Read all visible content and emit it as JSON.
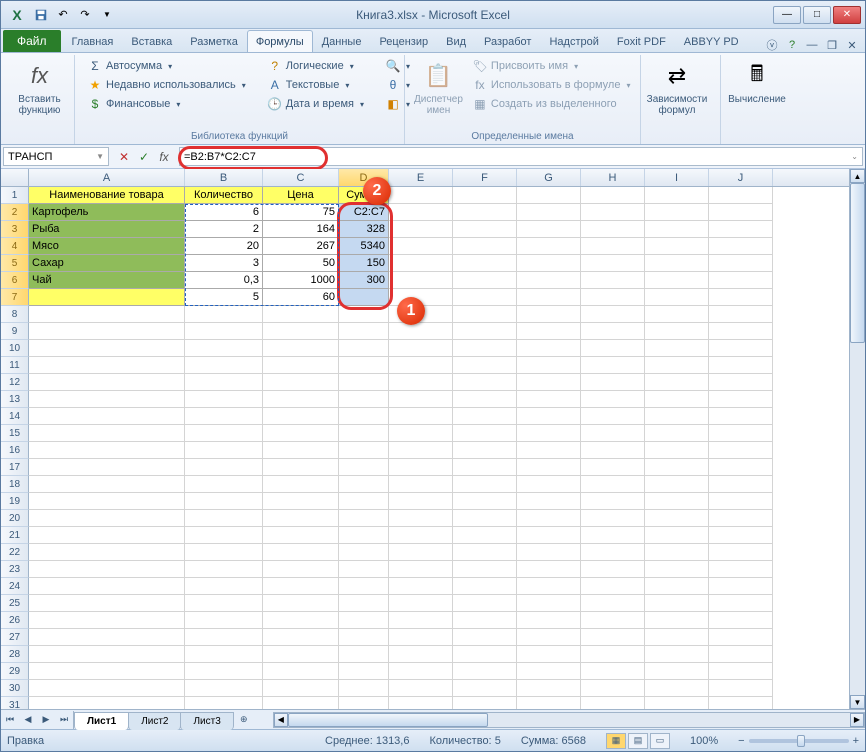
{
  "title": "Книга3.xlsx - Microsoft Excel",
  "ribbon": {
    "file": "Файл",
    "tabs": [
      "Главная",
      "Вставка",
      "Разметка",
      "Формулы",
      "Данные",
      "Рецензир",
      "Вид",
      "Разработ",
      "Надстрой",
      "Foxit PDF",
      "ABBYY PD"
    ],
    "activeTab": "Формулы",
    "groups": {
      "insertFn": {
        "label": "Вставить функцию"
      },
      "lib": {
        "label": "Библиотека функций",
        "autosum": "Автосумма",
        "recent": "Недавно использовались",
        "financial": "Финансовые",
        "logical": "Логические",
        "text": "Текстовые",
        "datetime": "Дата и время"
      },
      "names": {
        "label": "Определенные имена",
        "manager": "Диспетчер имен",
        "assign": "Присвоить имя",
        "useInFormula": "Использовать в формуле",
        "fromSelection": "Создать из выделенного"
      },
      "deps": "Зависимости формул",
      "calc": "Вычисление"
    }
  },
  "namebox": "ТРАНСП",
  "formula": "=B2:B7*C2:C7",
  "columns": [
    "A",
    "B",
    "C",
    "D",
    "E",
    "F",
    "G",
    "H",
    "I",
    "J"
  ],
  "headers": {
    "A": "Наименование товара",
    "B": "Количество",
    "C": "Цена",
    "D": "Сумма"
  },
  "rows": [
    {
      "n": "Картофель",
      "b": "6",
      "c": "75",
      "d": "C2:C7"
    },
    {
      "n": "Рыба",
      "b": "2",
      "c": "164",
      "d": "328"
    },
    {
      "n": "Мясо",
      "b": "20",
      "c": "267",
      "d": "5340"
    },
    {
      "n": "Сахар",
      "b": "3",
      "c": "50",
      "d": "150"
    },
    {
      "n": "Чай",
      "b": "0,3",
      "c": "1000",
      "d": "300"
    },
    {
      "n": "",
      "b": "5",
      "c": "60",
      "d": ""
    }
  ],
  "sheets": [
    "Лист1",
    "Лист2",
    "Лист3"
  ],
  "status": {
    "mode": "Правка",
    "avgLabel": "Среднее:",
    "avg": "1313,6",
    "countLabel": "Количество:",
    "count": "5",
    "sumLabel": "Сумма:",
    "sum": "6568",
    "zoom": "100%"
  },
  "callouts": {
    "c1": "1",
    "c2": "2"
  }
}
